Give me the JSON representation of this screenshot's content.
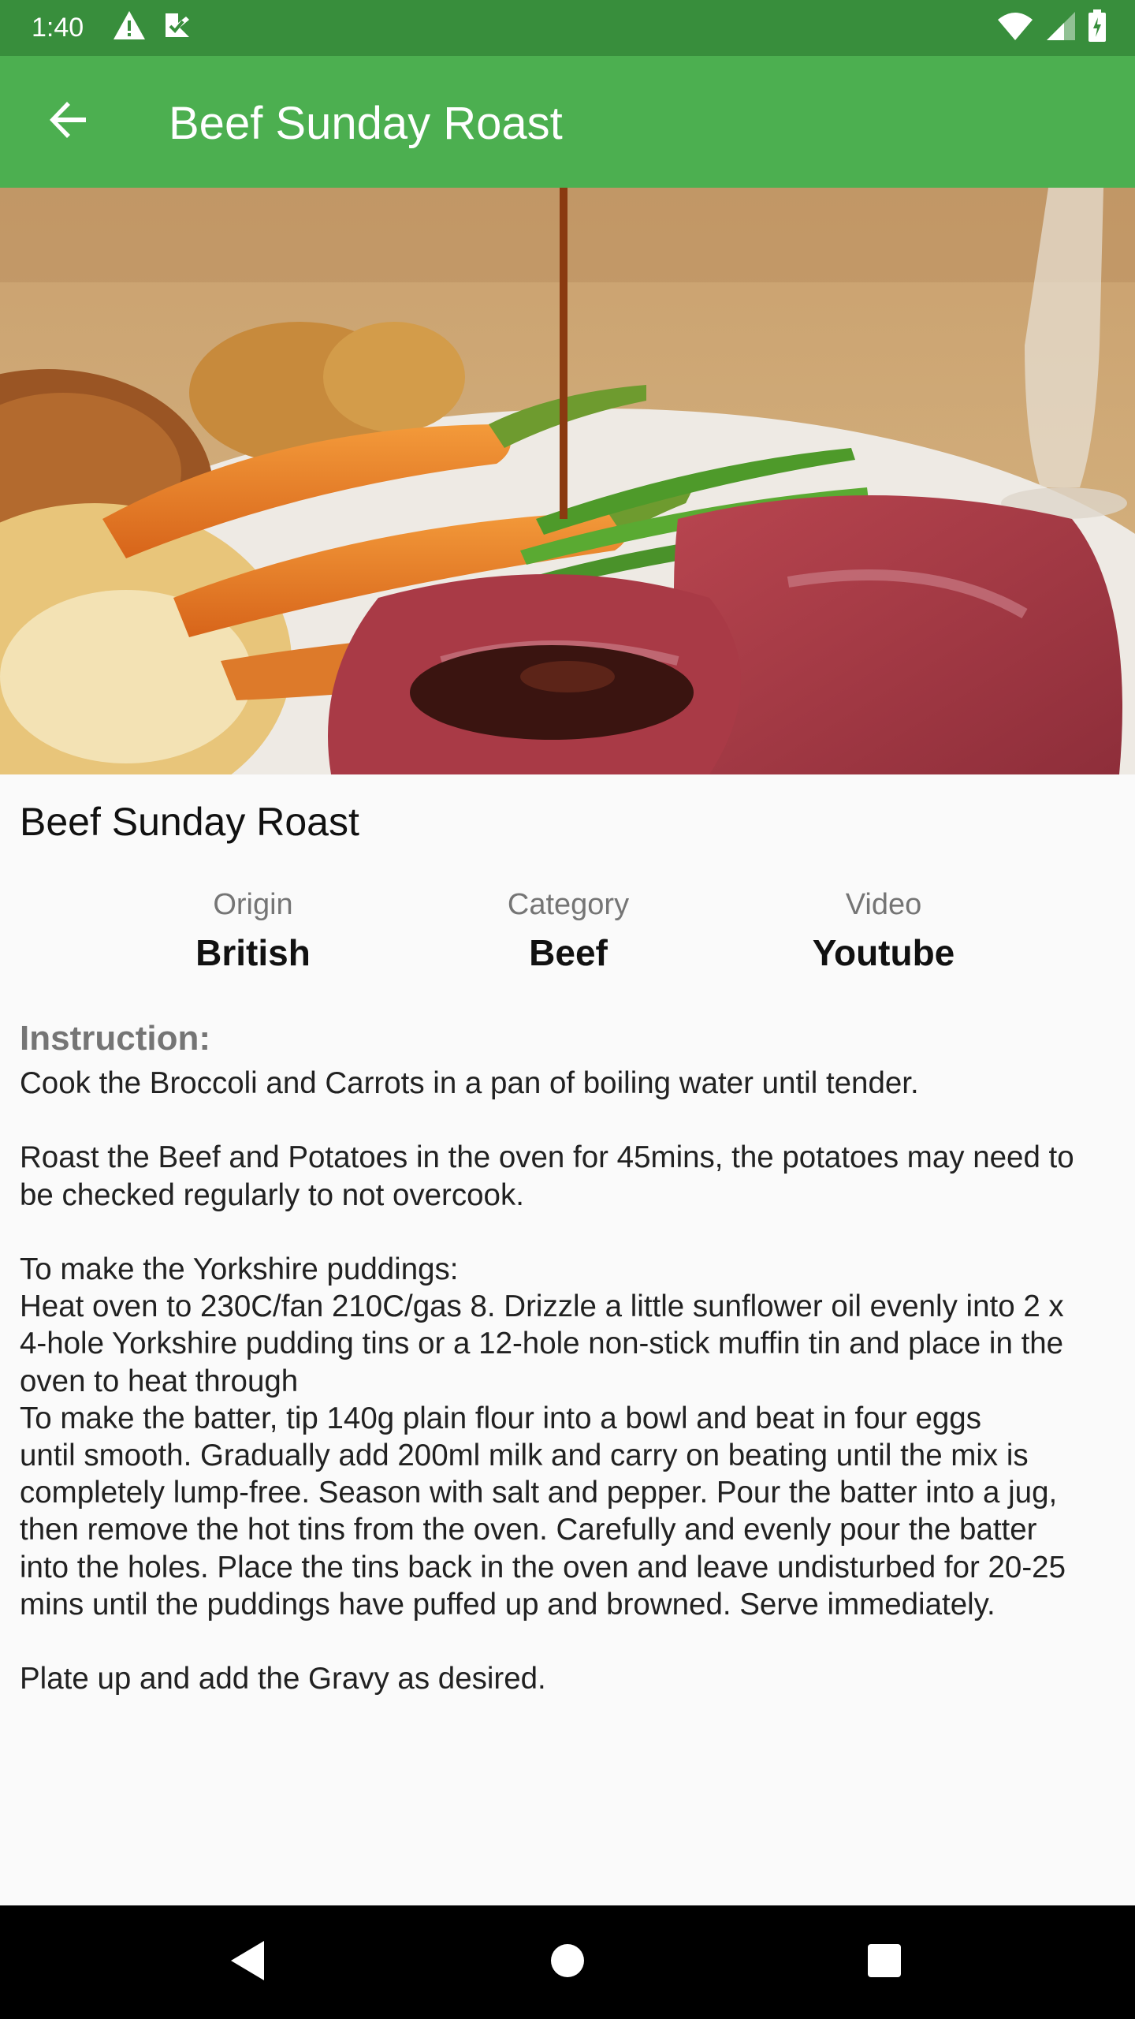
{
  "status_bar": {
    "time": "1:40",
    "left_icons": [
      "warning-icon",
      "notification-icon"
    ],
    "right_icons": [
      "wifi-icon",
      "signal-icon",
      "battery-icon"
    ]
  },
  "app_bar": {
    "back_icon": "arrow-back-icon",
    "title": "Beef Sunday Roast"
  },
  "hero_image": {
    "description_icon": "meal-photo"
  },
  "meal": {
    "name": "Beef Sunday Roast",
    "meta": [
      {
        "label": "Origin",
        "value": "British"
      },
      {
        "label": "Category",
        "value": "Beef"
      },
      {
        "label": "Video",
        "value": "Youtube"
      }
    ],
    "instruction_heading": "Instruction:",
    "instruction_lines": [
      "Cook the Broccoli and Carrots in a pan of boiling water until tender.",
      "",
      "Roast the Beef and Potatoes in the oven for 45mins, the potatoes may need to",
      "be checked regularly to not overcook.",
      "",
      "To make the Yorkshire puddings:",
      "Heat oven to 230C/fan 210C/gas 8. Drizzle a little sunflower oil evenly into 2 x",
      "4-hole Yorkshire pudding tins or a 12-hole non-stick muffin tin and place in the",
      "oven to heat through",
      "To make the batter, tip 140g plain flour into a bowl and beat in four eggs",
      "until smooth. Gradually add 200ml milk and carry on beating until the mix is",
      "completely lump-free. Season with salt and pepper. Pour the batter into a jug,",
      "then remove the hot tins from the oven. Carefully and evenly pour the batter",
      "into the holes. Place the tins back in the oven and leave undisturbed for 20-25",
      "mins until the puddings have puffed up and browned. Serve immediately.",
      "",
      "Plate up and add the Gravy as desired."
    ]
  },
  "nav_bar": {
    "buttons": [
      "back-triangle-icon",
      "home-circle-icon",
      "recents-square-icon"
    ]
  },
  "colors": {
    "status_bar": "#388E3C",
    "app_bar": "#4CAF50",
    "background": "#FAFAFA",
    "label_gray": "#757575"
  }
}
